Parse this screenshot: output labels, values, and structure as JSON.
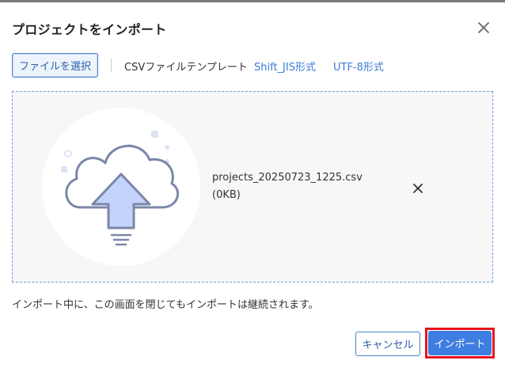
{
  "dialog": {
    "title": "プロジェクトをインポート",
    "close_icon": "close-icon"
  },
  "toolbar": {
    "file_select_label": "ファイルを選択",
    "template_label": "CSVファイルテンプレート",
    "links": [
      {
        "label": "Shift_JIS形式"
      },
      {
        "label": "UTF-8形式"
      }
    ]
  },
  "upload": {
    "illustration_icon": "cloud-upload-icon",
    "file_name": "projects_20250723_1225.csv",
    "file_size": "(0KB)",
    "remove_icon": "close-icon"
  },
  "note": "インポート中に、この画面を閉じてもインポートは継続されます。",
  "footer": {
    "cancel_label": "キャンセル",
    "import_label": "インポート"
  },
  "colors": {
    "accent": "#3d7ee0",
    "highlight": "#e8141d",
    "link": "#3a7bd5"
  }
}
